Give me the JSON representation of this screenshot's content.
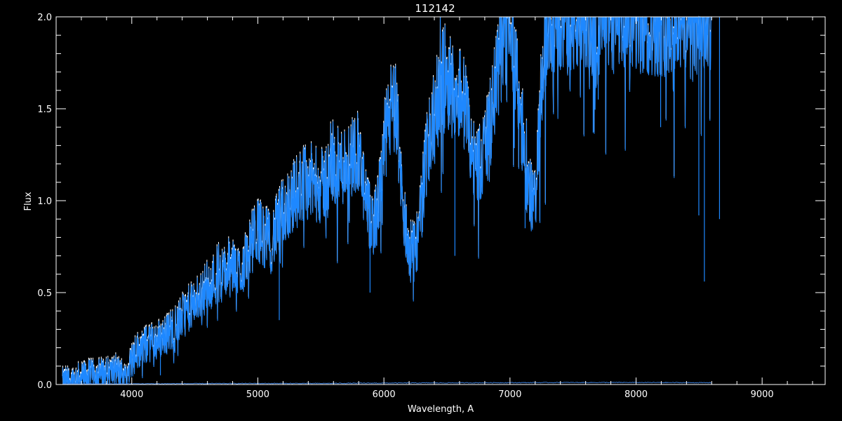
{
  "chart_data": {
    "type": "line",
    "title": "112142",
    "xlabel": "Wavelength, A",
    "ylabel": "Flux",
    "xlim": [
      3400,
      9500
    ],
    "ylim": [
      0.0,
      2.0
    ],
    "x_ticks": [
      {
        "value": 4000,
        "label": "4000"
      },
      {
        "value": 5000,
        "label": "5000"
      },
      {
        "value": 6000,
        "label": "6000"
      },
      {
        "value": 7000,
        "label": "7000"
      },
      {
        "value": 8000,
        "label": "8000"
      },
      {
        "value": 9000,
        "label": "9000"
      }
    ],
    "x_minor_step": 200,
    "y_ticks": [
      {
        "value": 0.0,
        "label": "0.0"
      },
      {
        "value": 0.5,
        "label": "0.5"
      },
      {
        "value": 1.0,
        "label": "1.0"
      },
      {
        "value": 1.5,
        "label": "1.5"
      },
      {
        "value": 2.0,
        "label": "2.0"
      }
    ],
    "y_minor_step": 0.1,
    "grid": false,
    "colors": {
      "background": "#000000",
      "axes": "#ffffff",
      "spectrum_white": "#ffffff",
      "spectrum_blue": "#1e88ff",
      "error_blue": "#3a7bd5"
    },
    "series": [
      {
        "role": "flux",
        "x": [
          3450,
          3500,
          3550,
          3600,
          3650,
          3700,
          3750,
          3800,
          3850,
          3900,
          3950,
          4000,
          4050,
          4100,
          4150,
          4200,
          4250,
          4300,
          4350,
          4400,
          4450,
          4500,
          4550,
          4600,
          4650,
          4700,
          4750,
          4800,
          4850,
          4900,
          4950,
          5000,
          5050,
          5100,
          5150,
          5200,
          5250,
          5300,
          5350,
          5400,
          5450,
          5500,
          5550,
          5600,
          5650,
          5700,
          5750,
          5800,
          5850,
          5900,
          5950,
          6000,
          6050,
          6100,
          6150,
          6200,
          6250,
          6300,
          6350,
          6400,
          6450,
          6500,
          6550,
          6600,
          6650,
          6700,
          6750,
          6800,
          6850,
          6900,
          6950,
          7000,
          7050,
          7100,
          7150,
          7200,
          7250,
          7300,
          7350,
          7400,
          7500,
          7600,
          7700,
          7800,
          7900,
          8000,
          8100,
          8200,
          8300,
          8400,
          8500,
          8550,
          8600
        ],
        "y": [
          0.02,
          0.03,
          0.04,
          0.05,
          0.06,
          0.06,
          0.07,
          0.07,
          0.08,
          0.08,
          0.05,
          0.15,
          0.2,
          0.22,
          0.24,
          0.25,
          0.27,
          0.3,
          0.33,
          0.38,
          0.42,
          0.45,
          0.5,
          0.55,
          0.58,
          0.6,
          0.62,
          0.64,
          0.62,
          0.68,
          0.78,
          0.85,
          0.82,
          0.78,
          0.86,
          0.95,
          1.0,
          1.05,
          1.1,
          1.12,
          1.1,
          1.08,
          1.12,
          1.2,
          1.18,
          1.22,
          1.25,
          1.3,
          1.0,
          0.88,
          0.95,
          1.3,
          1.5,
          1.5,
          0.95,
          0.75,
          0.72,
          1.0,
          1.35,
          1.45,
          1.65,
          1.7,
          1.6,
          1.62,
          1.5,
          1.25,
          1.2,
          1.28,
          1.45,
          1.7,
          1.9,
          2.0,
          1.75,
          1.3,
          1.05,
          1.0,
          1.6,
          2.0,
          2.0,
          2.0,
          2.0,
          2.0,
          2.0,
          2.0,
          2.0,
          2.0,
          2.0,
          2.0,
          2.0,
          2.0,
          2.0,
          2.0,
          2.0
        ]
      },
      {
        "role": "error",
        "x": [
          3450,
          4000,
          4500,
          5000,
          5500,
          6000,
          6500,
          7000,
          7500,
          8000,
          8500,
          8600
        ],
        "y": [
          0.002,
          0.002,
          0.003,
          0.004,
          0.004,
          0.006,
          0.007,
          0.008,
          0.009,
          0.009,
          0.008,
          0.008
        ]
      }
    ]
  }
}
